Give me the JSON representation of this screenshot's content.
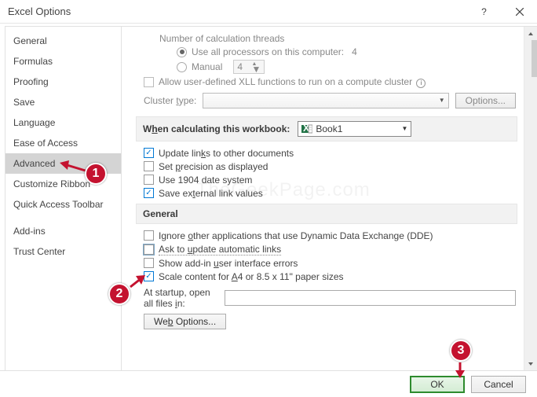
{
  "title": "Excel Options",
  "sidebar": {
    "items": [
      {
        "label": "General"
      },
      {
        "label": "Formulas"
      },
      {
        "label": "Proofing"
      },
      {
        "label": "Save"
      },
      {
        "label": "Language"
      },
      {
        "label": "Ease of Access"
      },
      {
        "label": "Advanced"
      },
      {
        "label": "Customize Ribbon"
      },
      {
        "label": "Quick Access Toolbar"
      },
      {
        "label": "Add-ins"
      },
      {
        "label": "Trust Center"
      }
    ]
  },
  "calc": {
    "threads_label": "Number of calculation threads",
    "use_all": "Use all processors on this computer:",
    "use_all_count": "4",
    "manual": "Manual",
    "manual_val": "4",
    "allow_xll": "Allow user-defined XLL functions to run on a compute cluster",
    "cluster_type": "Cluster type:",
    "options_btn": "Options..."
  },
  "workbook_section": {
    "title_pre": "W",
    "title_u": "h",
    "title_post": "en calculating this workbook:",
    "book": "Book1",
    "update_links": "Update links to other documents",
    "set_precision": "Set precision as displayed",
    "use_1904": "Use 1904 date system",
    "save_ext": "Save external link values"
  },
  "general": {
    "title": "General",
    "ignore_dde": "Ignore other applications that use Dynamic Data Exchange (DDE)",
    "ask_update": "Ask to update automatic links",
    "show_addin": "Show add-in user interface errors",
    "scale_a4": "Scale content for A4 or 8.5 x 11\" paper sizes",
    "startup1": "At startup, open",
    "startup2": "all files in:",
    "web_opt": "Web Options..."
  },
  "footer": {
    "ok": "OK",
    "cancel": "Cancel"
  },
  "annotations": {
    "n1": "1",
    "n2": "2",
    "n3": "3"
  },
  "watermark": "TheGeekPage.com"
}
